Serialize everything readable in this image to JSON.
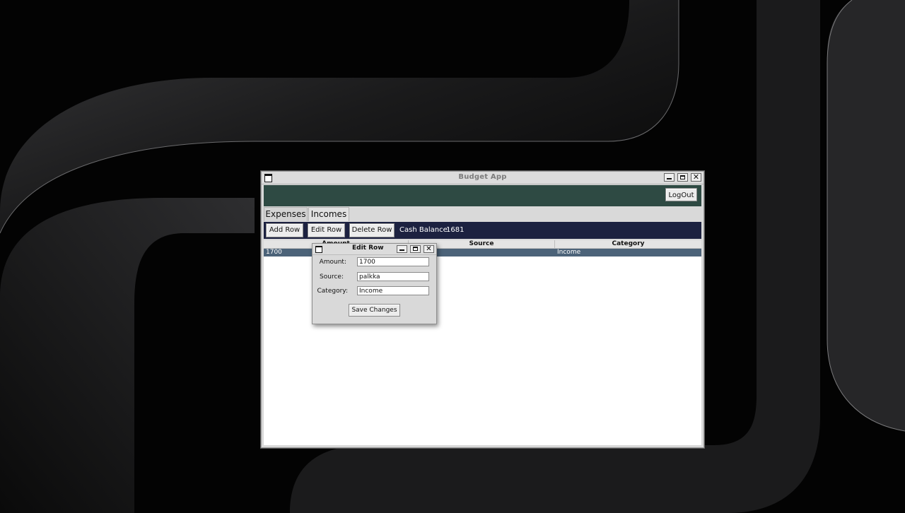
{
  "window": {
    "title": "Budget App",
    "logout_label": "LogOut"
  },
  "tabs": [
    {
      "label": "Expenses",
      "active": false
    },
    {
      "label": "Incomes",
      "active": true
    }
  ],
  "toolbar": {
    "add_label": "Add Row",
    "edit_label": "Edit Row",
    "delete_label": "Delete Row",
    "cash_label": "Cash Balance:",
    "cash_value": "1681"
  },
  "table": {
    "headers": [
      "Amount",
      "Source",
      "Category"
    ],
    "rows": [
      {
        "amount": "1700",
        "source": "palkka",
        "category": "Income"
      }
    ]
  },
  "dialog": {
    "title": "Edit Row",
    "amount_label": "Amount:",
    "amount_value": "1700",
    "source_label": "Source:",
    "source_value": "palkka",
    "category_label": "Category:",
    "category_value": "Income",
    "save_label": "Save Changes"
  },
  "colors": {
    "header_bar": "#2e4a43",
    "toolbar": "#1c2140",
    "selected_row": "#4c6379"
  }
}
